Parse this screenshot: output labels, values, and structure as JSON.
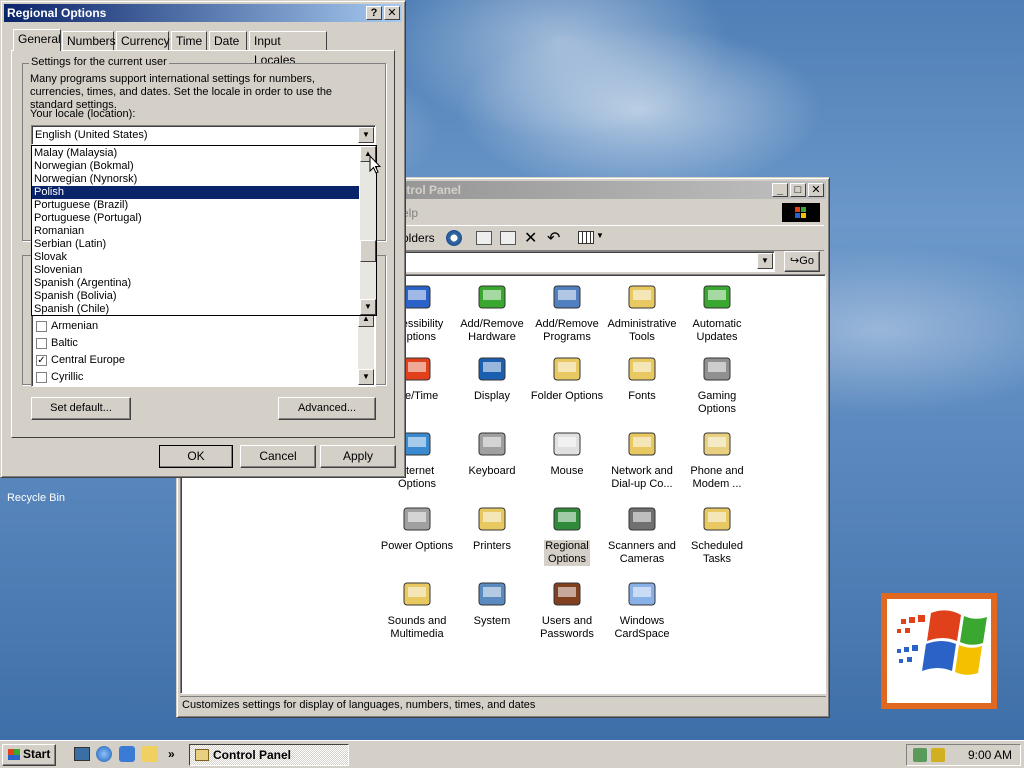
{
  "desktop": {
    "recycle_bin_label": "Recycle Bin"
  },
  "regional_dialog": {
    "title": "Regional Options",
    "help_btn": "?",
    "close_btn": "✕",
    "tabs": [
      "General",
      "Numbers",
      "Currency",
      "Time",
      "Date",
      "Input Locales"
    ],
    "active_tab": "General",
    "group_title": "Settings for the current user",
    "description": "Many programs support international settings for numbers, currencies, times, and dates. Set the locale in order to use the standard settings.",
    "locale_label": "Your locale (location):",
    "locale_value": "English (United States)",
    "locale_options": [
      "Malay (Malaysia)",
      "Norwegian (Bokmal)",
      "Norwegian (Nynorsk)",
      "Polish",
      "Portuguese (Brazil)",
      "Portuguese (Portugal)",
      "Romanian",
      "Serbian (Latin)",
      "Slovak",
      "Slovenian",
      "Spanish (Argentina)",
      "Spanish (Bolivia)",
      "Spanish (Chile)"
    ],
    "highlighted_option": "Polish",
    "language_settings": [
      {
        "label": "Armenian",
        "checked": false
      },
      {
        "label": "Baltic",
        "checked": false
      },
      {
        "label": "Central Europe",
        "checked": true
      },
      {
        "label": "Cyrillic",
        "checked": false
      }
    ],
    "set_default_btn": "Set default...",
    "advanced_btn": "Advanced...",
    "ok_btn": "OK",
    "cancel_btn": "Cancel",
    "apply_btn": "Apply"
  },
  "control_panel": {
    "title": "Control Panel",
    "menu_partial": "elp",
    "toolbar_folders": "olders",
    "go_label": "Go",
    "items": [
      {
        "label": "Accessibility Options",
        "display": "ccessibility\nOptions",
        "icon": "accessibility-icon"
      },
      {
        "label": "Add/Remove Hardware",
        "display": "Add/Remove\nHardware",
        "icon": "hardware-icon"
      },
      {
        "label": "Add/Remove Programs",
        "display": "Add/Remove\nPrograms",
        "icon": "programs-icon"
      },
      {
        "label": "Administrative Tools",
        "display": "Administrative\nTools",
        "icon": "admin-tools-icon"
      },
      {
        "label": "Automatic Updates",
        "display": "Automatic\nUpdates",
        "icon": "windows-update-icon"
      },
      {
        "label": "Date/Time",
        "display": "ate/Time",
        "icon": "datetime-icon"
      },
      {
        "label": "Display",
        "display": "Display",
        "icon": "display-icon"
      },
      {
        "label": "Folder Options",
        "display": "Folder Options",
        "icon": "folder-options-icon"
      },
      {
        "label": "Fonts",
        "display": "Fonts",
        "icon": "fonts-icon"
      },
      {
        "label": "Gaming Options",
        "display": "Gaming\nOptions",
        "icon": "joystick-icon"
      },
      {
        "label": "Internet Options",
        "display": "nternet\nOptions",
        "icon": "internet-icon"
      },
      {
        "label": "Keyboard",
        "display": "Keyboard",
        "icon": "keyboard-icon"
      },
      {
        "label": "Mouse",
        "display": "Mouse",
        "icon": "mouse-icon"
      },
      {
        "label": "Network and Dial-up Co...",
        "display": "Network and\nDial-up Co...",
        "icon": "network-icon"
      },
      {
        "label": "Phone and Modem ...",
        "display": "Phone and\nModem ...",
        "icon": "phone-icon"
      },
      {
        "label": "Power Options",
        "display": "Power Options",
        "icon": "power-icon"
      },
      {
        "label": "Printers",
        "display": "Printers",
        "icon": "printer-icon"
      },
      {
        "label": "Regional Options",
        "display": "Regional\nOptions",
        "icon": "globe-icon"
      },
      {
        "label": "Scanners and Cameras",
        "display": "Scanners and\nCameras",
        "icon": "scanner-icon"
      },
      {
        "label": "Scheduled Tasks",
        "display": "Scheduled\nTasks",
        "icon": "scheduled-tasks-icon"
      },
      {
        "label": "Sounds and Multimedia",
        "display": "Sounds and\nMultimedia",
        "icon": "speaker-icon"
      },
      {
        "label": "System",
        "display": "System",
        "icon": "computer-icon"
      },
      {
        "label": "Users and Passwords",
        "display": "Users and\nPasswords",
        "icon": "users-icon"
      },
      {
        "label": "Windows CardSpace",
        "display": "Windows\nCardSpace",
        "icon": "cardspace-icon"
      }
    ],
    "selected_item": "Regional Options",
    "status_text": "Customizes settings for display of languages, numbers, times, and dates"
  },
  "taskbar": {
    "start_label": "Start",
    "task_label": "Control Panel",
    "clock": "9:00 AM",
    "quicklaunch_more": "»"
  },
  "colors": {
    "title_active": "#0a246a",
    "face": "#d4d0c8",
    "selection": "#0a246a"
  }
}
